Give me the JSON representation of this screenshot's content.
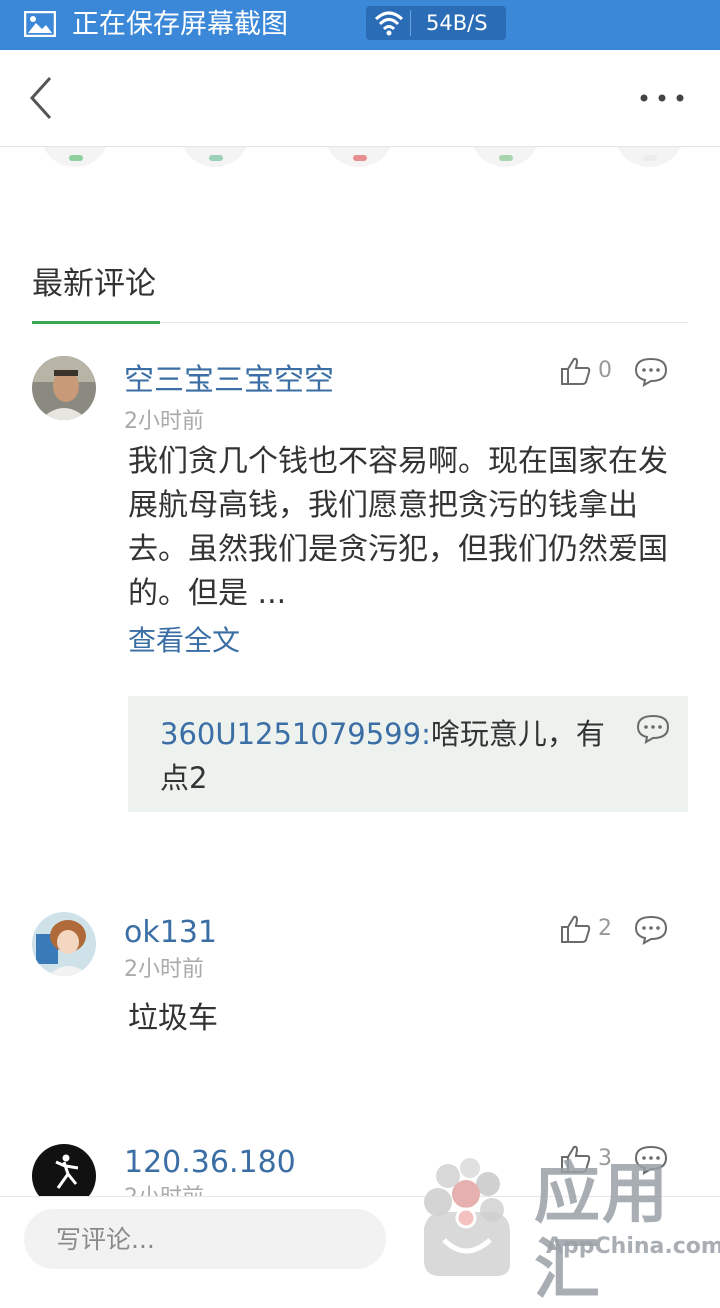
{
  "status_bar": {
    "text": "正在保存屏幕截图",
    "network_speed": "54B/S",
    "icons": [
      "picture-icon",
      "wifi-icon"
    ]
  },
  "nav": {
    "back_icon": "chevron-left-icon",
    "more_icon": "more-dots-icon"
  },
  "section": {
    "title": "最新评论",
    "accent_color": "#3aa757"
  },
  "comments": [
    {
      "username": "空三宝三宝空空",
      "time": "2小时前",
      "likes": "0",
      "text": "我们贪几个钱也不容易啊。现在国家在发展航母高钱，我们愿意把贪污的钱拿出去。虽然我们是贪污犯，但我们仍然爱国的。但是 ...",
      "read_more": "查看全文",
      "reply": {
        "author": "360U1251079599:",
        "text": "啥玩意儿，有点2"
      }
    },
    {
      "username": "ok131",
      "time": "2小时前",
      "likes": "2",
      "text": "垃圾车"
    },
    {
      "username": "120.36.180",
      "time": "2小时前",
      "likes": "3"
    }
  ],
  "bottom_bar": {
    "input_placeholder": "写评论..."
  },
  "watermark": {
    "title": "应用汇",
    "subtitle": "AppChina.com"
  },
  "colors": {
    "status_bar": "#3b87d8",
    "link": "#3a6ea5",
    "reply_bg": "#eef2ee"
  }
}
